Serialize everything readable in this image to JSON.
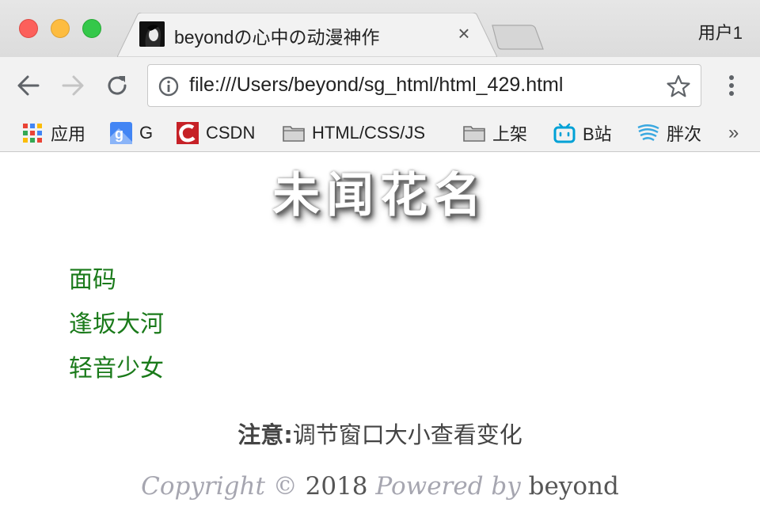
{
  "browser": {
    "tab": {
      "title": "beyondの心中の动漫神作",
      "close_glyph": "×"
    },
    "profile_label": "用户1",
    "address_bar": {
      "url": "file:///Users/beyond/sg_html/html_429.html"
    },
    "bookmarks": [
      {
        "label": "应用",
        "icon": "apps-grid-icon"
      },
      {
        "label": "G",
        "icon": "google-maps-icon"
      },
      {
        "label": "CSDN",
        "icon": "csdn-icon"
      },
      {
        "label": "HTML/CSS/JS",
        "icon": "folder-icon"
      },
      {
        "label": "上架",
        "icon": "folder-icon"
      },
      {
        "label": "B站",
        "icon": "bilibili-icon"
      },
      {
        "label": "胖次",
        "icon": "wave-icon"
      }
    ],
    "bookmarks_more_glyph": "»"
  },
  "page": {
    "title": "未闻花名",
    "anime_list": [
      "面码",
      "逢坂大河",
      "轻音少女"
    ],
    "note_label": "注意:",
    "note_text": "调节窗口大小查看变化",
    "copyright": {
      "prefix": "Copyright ©",
      "year": "2018",
      "powered": "Powered by",
      "author": "beyond"
    }
  },
  "colors": {
    "list_text": "#1a7a1a",
    "chrome_bg": "#f2f2f2",
    "traffic_red": "#fc605b",
    "traffic_yellow": "#fdbc40",
    "traffic_green": "#34c84a"
  }
}
